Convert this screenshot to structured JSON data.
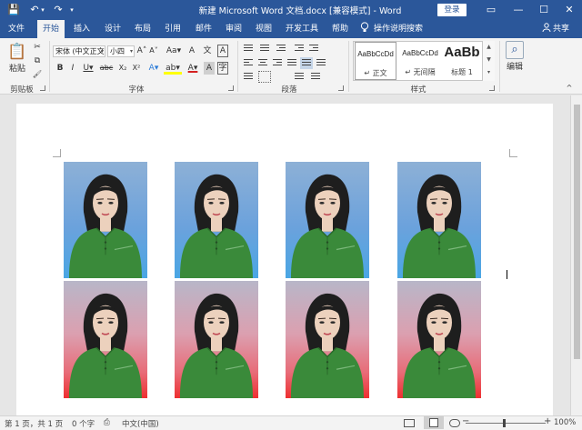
{
  "titlebar": {
    "save_icon": "save-icon",
    "undo_icon": "undo-icon",
    "redo_icon": "redo-icon",
    "title": "新建 Microsoft Word 文档.docx [兼容模式] - Word",
    "login_label": "登录",
    "glyphs": {
      "save": "💾",
      "undo": "↶",
      "undo_arrow": "▾",
      "redo": "↷",
      "customize": "▾",
      "ribbon_options": "▭",
      "minimize": "—",
      "maximize": "☐",
      "close": "✕"
    }
  },
  "menu": {
    "tabs": [
      "文件",
      "开始",
      "插入",
      "设计",
      "布局",
      "引用",
      "邮件",
      "审阅",
      "视图",
      "开发工具",
      "帮助"
    ],
    "active_tab": "开始",
    "tell_me_icon": "lightbulb-icon",
    "tell_me": "操作说明搜索",
    "share_icon": "person-icon",
    "share": "共享"
  },
  "ribbon": {
    "clipboard": {
      "paste": "粘贴",
      "label": "剪贴板",
      "cut_icon": "scissors-icon",
      "copy_icon": "copy-icon",
      "format_painter_icon": "brush-icon",
      "glyphs": {
        "paste": "📋",
        "cut": "✂",
        "copy": "⧉",
        "painter": "🖌"
      }
    },
    "font": {
      "font_name": "宋体 (中文正文)",
      "font_size": "小四",
      "label": "字体",
      "row1": [
        "A˄",
        "A˅",
        "Aa▾",
        "A",
        "文"
      ],
      "row2": [
        "B",
        "I",
        "U▾",
        "abc",
        "X₂",
        "X²"
      ],
      "row3": [
        "A▾",
        "ab▾",
        "A▾",
        "A",
        "字"
      ],
      "combo_arrow": "▾",
      "font_color": "#d42020",
      "highlight_color": "#ffff00"
    },
    "paragraph": {
      "label": "段落"
    },
    "styles": {
      "label": "样式",
      "items": [
        {
          "sample": "AaBbCcDd",
          "name": "↵ 正文"
        },
        {
          "sample": "AaBbCcDd",
          "name": "↵ 无间隔"
        },
        {
          "sample": "AaBb",
          "name": "标题 1"
        }
      ],
      "scroll_glyphs": [
        "▲",
        "▼",
        "▾"
      ]
    },
    "editing": {
      "label": "编辑",
      "icon": "find-icon",
      "glyph": "⌕"
    }
  },
  "document": {
    "photos_top_row_background": "blue",
    "photos_bottom_row_background": "red",
    "photo_count": 8,
    "colors": {
      "shirt": "#3a8a3a",
      "hair": "#1e1e1e",
      "skin": "#ecd1bd"
    }
  },
  "status": {
    "page": "第 1 页，共 1 页",
    "words": "0 个字",
    "proofing_icon": "proofing-icon",
    "proofing_glyph": "⎙",
    "language": "中文(中国)",
    "view_icons": [
      "read-mode-icon",
      "print-layout-icon",
      "web-layout-icon"
    ],
    "zoom_out": "−",
    "zoom_in": "+",
    "zoom": "100%"
  },
  "colors": {
    "accent": "#2b579a",
    "ribbon_bg": "#f3f3f3",
    "doc_bg": "#e6e6e6"
  }
}
